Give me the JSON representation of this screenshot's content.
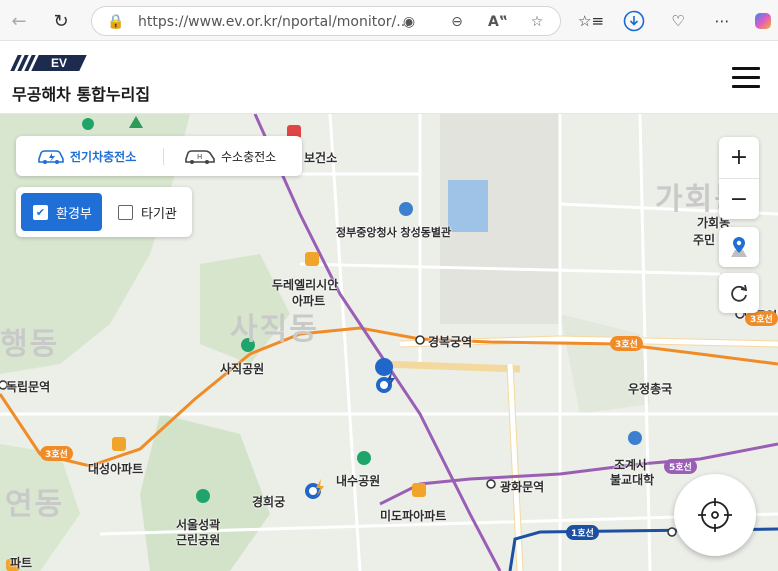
{
  "browser": {
    "url": "https://www.ev.or.kr/nportal/monitor/...",
    "icons": [
      "back-icon",
      "refresh-icon",
      "lock-icon",
      "tracking-icon",
      "zoom-out-icon",
      "read-aloud-icon",
      "favorite-star-icon",
      "favorites-icon",
      "download-icon",
      "health-icon",
      "more-icon",
      "copilot-icon"
    ]
  },
  "header": {
    "logo_text": "EV",
    "title": "무공해차 통합누리집"
  },
  "filters": {
    "ev_label": "전기차충전소",
    "hydrogen_label": "수소충전소",
    "org_on_label": "환경부",
    "org_off_label": "타기관"
  },
  "controls": {
    "zoom_in": "+",
    "zoom_out": "−"
  },
  "map": {
    "big_labels": [
      "사직동",
      "가회동",
      "연동",
      "행동"
    ],
    "labels": [
      "정부중앙청사 창성동별관",
      "두레엘리시안",
      "아파트",
      "경복궁역",
      "사직공원",
      "우정총국",
      "독립문역",
      "대성아파트",
      "내수공원",
      "광화문역",
      "조계사",
      "불교대학",
      "경희궁",
      "서울성곽",
      "근린공원",
      "미도파아파트",
      "가회동",
      "주민",
      "안국역",
      "파트",
      "보건소"
    ],
    "line_tags": [
      "3호선",
      "3호선",
      "5호선",
      "1호선",
      "3호선"
    ],
    "colors": {
      "line3": "#f08c28",
      "line5": "#9a5fb5",
      "line1": "#1d4fa3",
      "purple_road": "#9a5fb5",
      "accent": "#1f6fd6"
    }
  }
}
